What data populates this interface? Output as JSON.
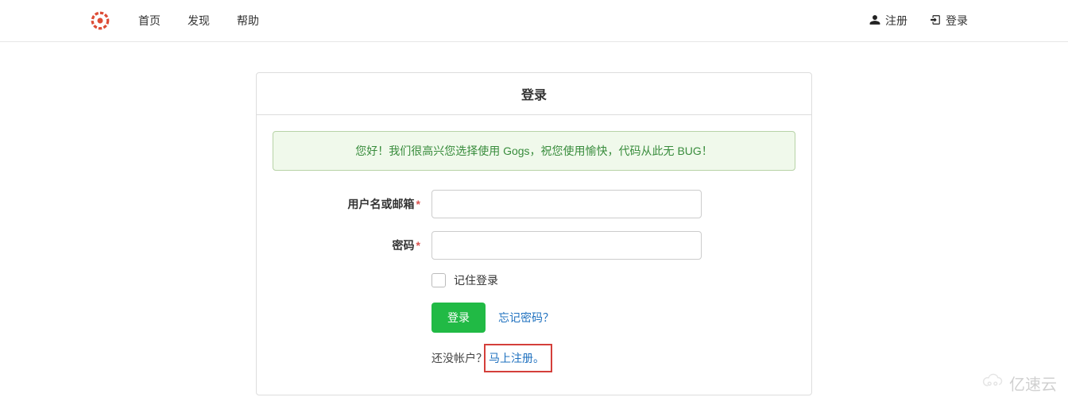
{
  "nav": {
    "home": "首页",
    "explore": "发现",
    "help": "帮助",
    "register": "注册",
    "login": "登录"
  },
  "panel": {
    "title": "登录"
  },
  "alert": {
    "text": "您好！我们很高兴您选择使用 Gogs，祝您使用愉快，代码从此无 BUG！"
  },
  "form": {
    "username_label": "用户名或邮箱",
    "password_label": "密码",
    "remember_label": "记住登录",
    "submit_label": "登录",
    "forgot_label": "忘记密码？",
    "no_account_label": "还没帐户？",
    "signup_label": "马上注册。",
    "username_value": "",
    "password_value": ""
  },
  "watermark": {
    "text": "亿速云"
  }
}
